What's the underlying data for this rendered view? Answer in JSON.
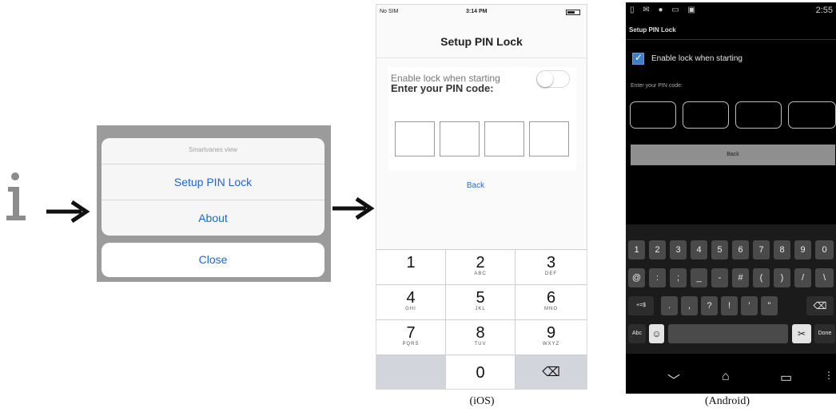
{
  "flow": {
    "info_glyph": "i",
    "arrow_icon": "right-arrow-icon"
  },
  "action_sheet": {
    "title": "Smartvanes view",
    "items": [
      "Setup PIN Lock",
      "About"
    ],
    "close_label": "Close"
  },
  "ios": {
    "status": {
      "carrier": "No SIM",
      "time": "3:14 PM"
    },
    "nav_title": "Setup PIN Lock",
    "enable_label": "Enable lock when starting",
    "enable_on": false,
    "pin_label": "Enter your PIN code:",
    "back_label": "Back",
    "keypad": [
      {
        "num": "1",
        "sub": ""
      },
      {
        "num": "2",
        "sub": "ABC"
      },
      {
        "num": "3",
        "sub": "DEF"
      },
      {
        "num": "4",
        "sub": "GHI"
      },
      {
        "num": "5",
        "sub": "JKL"
      },
      {
        "num": "6",
        "sub": "MNO"
      },
      {
        "num": "7",
        "sub": "PQRS"
      },
      {
        "num": "8",
        "sub": "TUV"
      },
      {
        "num": "9",
        "sub": "WXYZ"
      },
      {
        "num": "",
        "sub": ""
      },
      {
        "num": "0",
        "sub": ""
      },
      {
        "num": "⌫",
        "sub": ""
      }
    ],
    "caption": "(iOS)"
  },
  "android": {
    "status_right": "2:55",
    "title": "Setup PIN Lock",
    "enable_label": "Enable lock when starting",
    "enable_on": true,
    "pin_label": "Enter your PIN code:",
    "back_label": "Back",
    "keyboard": {
      "row1": [
        "1",
        "2",
        "3",
        "4",
        "5",
        "6",
        "7",
        "8",
        "9",
        "0"
      ],
      "row2": [
        "@",
        ":",
        ";",
        "_",
        "-",
        "#",
        "(",
        ")",
        "/",
        "\\"
      ],
      "row3": [
        "+=$",
        ".",
        ",",
        "?",
        "!",
        "'",
        "\"",
        "⌫"
      ],
      "row4": [
        "Abc",
        "☺",
        "",
        "✂",
        "Done"
      ]
    },
    "caption": "(Android)"
  },
  "colors": {
    "ios_blue": "#1b67d6",
    "android_check": "#3f7fc6"
  }
}
